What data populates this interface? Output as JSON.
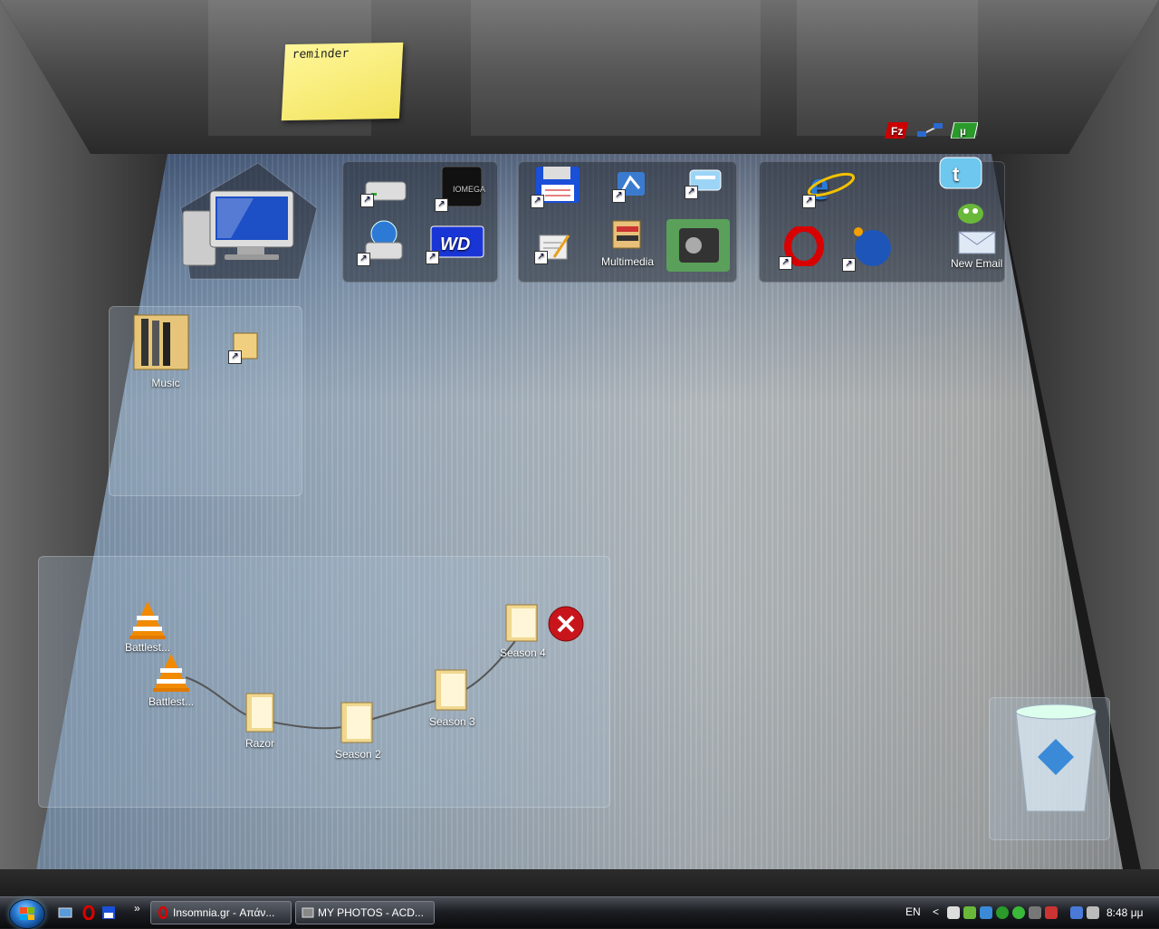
{
  "sticky_note": {
    "text": "reminder"
  },
  "fences": {
    "multimedia": {
      "label": "Multimedia"
    },
    "internet": {
      "new_email_label": "New Email"
    },
    "music": {
      "label": "Music"
    },
    "series": {
      "items": [
        {
          "label": "Battlest..."
        },
        {
          "label": "Battlest..."
        },
        {
          "label": "Razor"
        },
        {
          "label": "Season 2"
        },
        {
          "label": "Season 3"
        },
        {
          "label": "Season 4"
        }
      ]
    }
  },
  "taskbar": {
    "more_chevron": "»",
    "tasks": [
      {
        "label": "Insomnia.gr - Απάν..."
      },
      {
        "label": "MY PHOTOS - ACD..."
      }
    ],
    "language": "EN",
    "tray_chevron": "<",
    "clock": "8:48 μμ"
  },
  "colors": {
    "sticky": "#f7ea72",
    "close_badge": "#c8151b",
    "taskbar": "#1c1f24"
  }
}
